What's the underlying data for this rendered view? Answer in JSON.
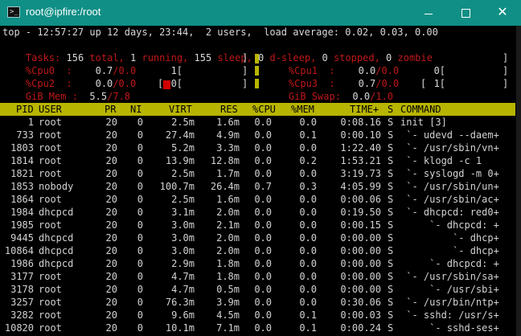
{
  "window": {
    "title": "root@ipfire:/root",
    "icon_label": ">_",
    "buttons": {
      "minimize": "",
      "maximize": "",
      "close": "✕"
    }
  },
  "summary": {
    "line": "top - 12:57:27 up 12 days, 23:44,  2 users,  load average: 0.02, 0.03, 0.00",
    "tasks_label": "Tasks:",
    "tasks_total": "156",
    "total_label": "total,",
    "tasks_running": "1",
    "running_label": "running,",
    "tasks_sleep": "155",
    "sleep_label": "sleep,",
    "tasks_dsleep": "0",
    "dsleep_label": "d-sleep,",
    "tasks_stopped": "0",
    "stopped_label": "stopped,",
    "tasks_zombie": "0",
    "zombie_label": "zombie"
  },
  "cpu_meters": [
    {
      "label": "%Cpu0  :",
      "us": "0.7",
      "sy": "0.0",
      "bar_prefix": "1[",
      "bar_end": "]"
    },
    {
      "label": "%Cpu1  :",
      "us": "0.0",
      "sy": "0.0",
      "bar_prefix": "0[",
      "bar_end": "]"
    },
    {
      "label": "%Cpu2  :",
      "us": "0.0",
      "sy": "0.0",
      "bar_prefix": "0[",
      "bar_end": "]"
    },
    {
      "label": "%Cpu3  :",
      "us": "0.7",
      "sy": "0.0",
      "bar_prefix": "1[",
      "bar_end": "]"
    }
  ],
  "memory": {
    "mem_label": "GiB Mem :",
    "mem_used": "5.5",
    "mem_total": "7.8",
    "mem_bar_end": "]",
    "swap_label": "GiB Swap:",
    "swap_used": "0.0",
    "swap_total": "1.0",
    "swap_bar_start": "[",
    "swap_bar_end": "]",
    "sep": "/"
  },
  "columns": {
    "pid": "PID",
    "user": "USER",
    "pr": "PR",
    "ni": "NI",
    "virt": "VIRT",
    "res": "RES",
    "cpu": "%CPU",
    "mem": "%MEM",
    "time": "TIME+",
    "s": "S",
    "command": "COMMAND"
  },
  "processes": [
    {
      "pid": "1",
      "user": "root",
      "pr": "20",
      "ni": "0",
      "virt": "2.5m",
      "res": "1.6m",
      "cpu": "0.0",
      "mem": "0.0",
      "time": "0:08.16",
      "s": "S",
      "command": "init [3]"
    },
    {
      "pid": "733",
      "user": "root",
      "pr": "20",
      "ni": "0",
      "virt": "27.4m",
      "res": "4.9m",
      "cpu": "0.0",
      "mem": "0.1",
      "time": "0:00.10",
      "s": "S",
      "command": " `- udevd --daem+"
    },
    {
      "pid": "1803",
      "user": "root",
      "pr": "20",
      "ni": "0",
      "virt": "5.2m",
      "res": "3.3m",
      "cpu": "0.0",
      "mem": "0.0",
      "time": "1:22.40",
      "s": "S",
      "command": " `- /usr/sbin/vn+"
    },
    {
      "pid": "1814",
      "user": "root",
      "pr": "20",
      "ni": "0",
      "virt": "13.9m",
      "res": "12.8m",
      "cpu": "0.0",
      "mem": "0.2",
      "time": "1:53.21",
      "s": "S",
      "command": " `- klogd -c 1"
    },
    {
      "pid": "1821",
      "user": "root",
      "pr": "20",
      "ni": "0",
      "virt": "2.5m",
      "res": "1.7m",
      "cpu": "0.0",
      "mem": "0.0",
      "time": "3:19.73",
      "s": "S",
      "command": " `- syslogd -m 0+"
    },
    {
      "pid": "1853",
      "user": "nobody",
      "pr": "20",
      "ni": "0",
      "virt": "100.7m",
      "res": "26.4m",
      "cpu": "0.7",
      "mem": "0.3",
      "time": "4:05.99",
      "s": "S",
      "command": " `- /usr/sbin/un+"
    },
    {
      "pid": "1864",
      "user": "root",
      "pr": "20",
      "ni": "0",
      "virt": "2.5m",
      "res": "1.6m",
      "cpu": "0.0",
      "mem": "0.0",
      "time": "0:00.06",
      "s": "S",
      "command": " `- /usr/sbin/ac+"
    },
    {
      "pid": "1984",
      "user": "dhcpcd",
      "pr": "20",
      "ni": "0",
      "virt": "3.1m",
      "res": "2.0m",
      "cpu": "0.0",
      "mem": "0.0",
      "time": "0:19.50",
      "s": "S",
      "command": " `- dhcpcd: red0+"
    },
    {
      "pid": "1985",
      "user": "root",
      "pr": "20",
      "ni": "0",
      "virt": "3.0m",
      "res": "2.1m",
      "cpu": "0.0",
      "mem": "0.0",
      "time": "0:00.15",
      "s": "S",
      "command": "     `- dhcpcd: +"
    },
    {
      "pid": "9445",
      "user": "dhcpcd",
      "pr": "20",
      "ni": "0",
      "virt": "3.0m",
      "res": "2.0m",
      "cpu": "0.0",
      "mem": "0.0",
      "time": "0:00.00",
      "s": "S",
      "command": "         `- dhcp+"
    },
    {
      "pid": "10864",
      "user": "dhcpcd",
      "pr": "20",
      "ni": "0",
      "virt": "3.0m",
      "res": "2.0m",
      "cpu": "0.0",
      "mem": "0.0",
      "time": "0:00.00",
      "s": "S",
      "command": "         `- dhcp+"
    },
    {
      "pid": "1986",
      "user": "dhcpcd",
      "pr": "20",
      "ni": "0",
      "virt": "2.9m",
      "res": "1.8m",
      "cpu": "0.0",
      "mem": "0.0",
      "time": "0:00.00",
      "s": "S",
      "command": "     `- dhcpcd: +"
    },
    {
      "pid": "3177",
      "user": "root",
      "pr": "20",
      "ni": "0",
      "virt": "4.7m",
      "res": "1.8m",
      "cpu": "0.0",
      "mem": "0.0",
      "time": "0:00.00",
      "s": "S",
      "command": " `- /usr/sbin/sa+"
    },
    {
      "pid": "3178",
      "user": "root",
      "pr": "20",
      "ni": "0",
      "virt": "4.7m",
      "res": "0.5m",
      "cpu": "0.0",
      "mem": "0.0",
      "time": "0:00.00",
      "s": "S",
      "command": "     `- /usr/sbi+"
    },
    {
      "pid": "3257",
      "user": "root",
      "pr": "20",
      "ni": "0",
      "virt": "76.3m",
      "res": "3.9m",
      "cpu": "0.0",
      "mem": "0.0",
      "time": "0:30.06",
      "s": "S",
      "command": " `- /usr/bin/ntp+"
    },
    {
      "pid": "3282",
      "user": "root",
      "pr": "20",
      "ni": "0",
      "virt": "9.6m",
      "res": "4.5m",
      "cpu": "0.0",
      "mem": "0.1",
      "time": "0:00.03",
      "s": "S",
      "command": " `- sshd: /usr/s+"
    },
    {
      "pid": "10820",
      "user": "root",
      "pr": "20",
      "ni": "0",
      "virt": "10.1m",
      "res": "7.1m",
      "cpu": "0.0",
      "mem": "0.1",
      "time": "0:00.24",
      "s": "S",
      "command": "     `- sshd-ses+"
    }
  ]
}
